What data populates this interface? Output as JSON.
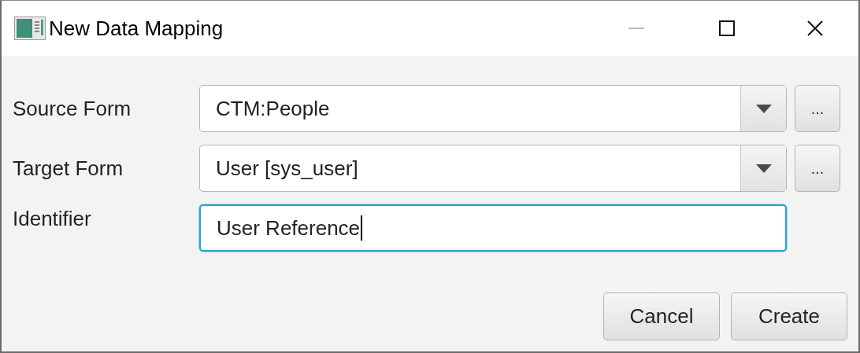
{
  "window": {
    "title": "New Data Mapping"
  },
  "fields": [
    {
      "kind": "combo",
      "label": "Source Form",
      "value": "CTM:People",
      "browse": "...",
      "focused": false
    },
    {
      "kind": "combo",
      "label": "Target Form",
      "value": "User [sys_user]",
      "browse": "...",
      "focused": false
    },
    {
      "kind": "text",
      "label": "Identifier",
      "value": "User Reference",
      "focused": true
    }
  ],
  "buttons": [
    "Cancel",
    "Create"
  ]
}
